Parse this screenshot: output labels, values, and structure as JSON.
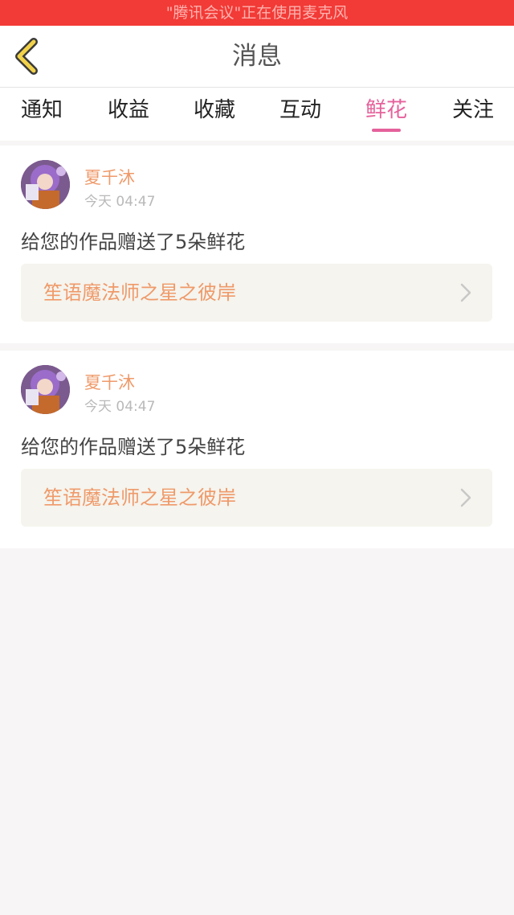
{
  "status_bar": {
    "text": "\"腾讯会议\"正在使用麦克风"
  },
  "nav": {
    "title": "消息",
    "back_icon": "back-chevron-icon"
  },
  "tabs": [
    {
      "label": "通知",
      "active": false
    },
    {
      "label": "收益",
      "active": false
    },
    {
      "label": "收藏",
      "active": false
    },
    {
      "label": "互动",
      "active": false
    },
    {
      "label": "鲜花",
      "active": true
    },
    {
      "label": "关注",
      "active": false
    }
  ],
  "colors": {
    "accent": "#e5619b",
    "username": "#ef9a6a",
    "status_bar": "#f23a36"
  },
  "messages": [
    {
      "username": "夏千沐",
      "time": "今天 04:47",
      "text": "给您的作品赠送了5朵鲜花",
      "work_title": "笙语魔法师之星之彼岸"
    },
    {
      "username": "夏千沐",
      "time": "今天 04:47",
      "text": "给您的作品赠送了5朵鲜花",
      "work_title": "笙语魔法师之星之彼岸"
    }
  ]
}
